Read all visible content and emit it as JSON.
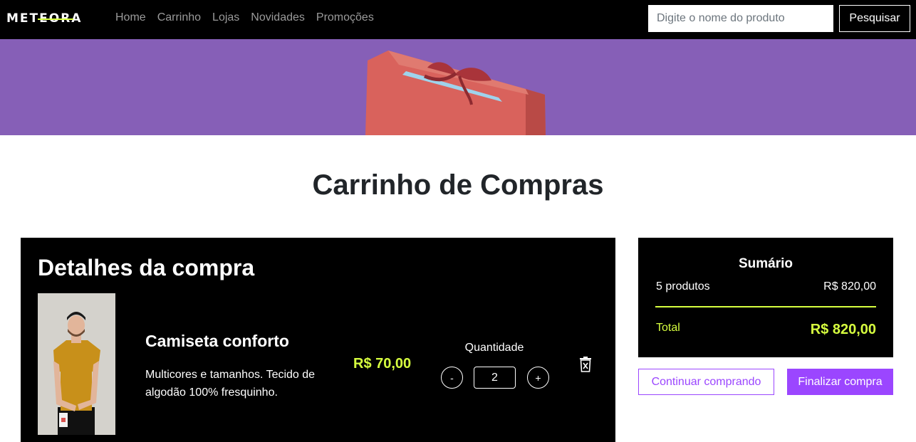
{
  "brand": {
    "logo_text": "METEORA"
  },
  "nav": {
    "links": [
      "Home",
      "Carrinho",
      "Lojas",
      "Novidades",
      "Promoções"
    ]
  },
  "search": {
    "placeholder": "Digite o nome do produto",
    "button_label": "Pesquisar"
  },
  "page": {
    "title": "Carrinho de Compras"
  },
  "details": {
    "title": "Detalhes da compra",
    "item": {
      "name": "Camiseta conforto",
      "description": "Multicores e tamanhos. Tecido de algodão 100% fresquinho.",
      "price": "R$ 70,00",
      "quantity_label": "Quantidade",
      "quantity": "2",
      "minus_label": "-",
      "plus_label": "+"
    }
  },
  "summary": {
    "title": "Sumário",
    "count_label": "5 produtos",
    "count_value": "R$ 820,00",
    "total_label": "Total",
    "total_value": "R$ 820,00"
  },
  "actions": {
    "continue_label": "Continuar comprando",
    "finish_label": "Finalizar compra"
  },
  "colors": {
    "accent": "#d7ff3f",
    "purple": "#9b46ff",
    "banner": "#865fb7"
  }
}
